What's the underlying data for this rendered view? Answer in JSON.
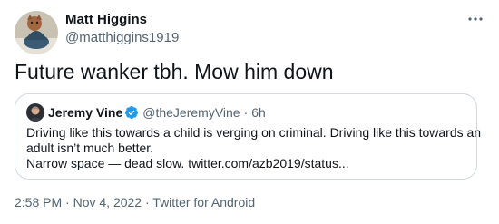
{
  "author": {
    "name": "Matt Higgins",
    "handle": "@matthiggins1919"
  },
  "tweet": {
    "text": "Future wanker tbh. Mow him down"
  },
  "quoted_tweet": {
    "name": "Jeremy Vine",
    "handle": "@theJeremyVine",
    "separator": "·",
    "time": "6h",
    "lines": [
      "Driving like this towards a child is verging on criminal. Driving like this towards an",
      "adult isn’t much better.",
      "Narrow space — dead slow. twitter.com/azb2019/status..."
    ]
  },
  "meta": {
    "time": "2:58 PM",
    "sep1": "·",
    "date": "Nov 4, 2022",
    "sep2": "·",
    "source": "Twitter for Android"
  },
  "icons": {
    "more": "more-horizontal-icon",
    "verified": "verified-badge-icon"
  },
  "colors": {
    "text": "#0f1419",
    "secondary": "#536471",
    "border": "#cfd9de",
    "verified": "#1d9bf0"
  }
}
